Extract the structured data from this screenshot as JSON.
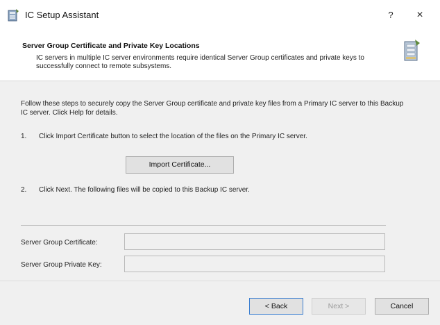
{
  "window": {
    "title": "IC Setup Assistant",
    "help_label": "?",
    "close_label": "×"
  },
  "header": {
    "title": "Server Group Certificate and Private Key Locations",
    "description": "IC servers in multiple IC server environments require identical Server Group certificates and private keys to successfully connect to remote subsystems."
  },
  "content": {
    "intro": "Follow these steps to securely copy the Server Group certificate and private key files from a Primary IC server to this Backup IC server. Click Help for details.",
    "steps": [
      {
        "num": "1.",
        "text": "Click Import Certificate button to select the location of the files on the Primary IC server."
      },
      {
        "num": "2.",
        "text": "Click Next. The following files will be copied to this Backup IC server."
      }
    ],
    "import_button": "Import Certificate...",
    "fields": [
      {
        "label": "Server Group Certificate:",
        "value": ""
      },
      {
        "label": "Server Group Private Key:",
        "value": ""
      }
    ]
  },
  "footer": {
    "back_label": "< Back",
    "next_label": "Next >",
    "cancel_label": "Cancel"
  },
  "colors": {
    "window_bg": "#f0f0f0",
    "header_bg": "#ffffff",
    "focus_border": "#3c7fd1"
  }
}
